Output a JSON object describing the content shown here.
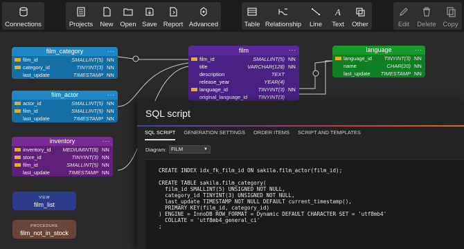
{
  "toolbar": {
    "connections": "Connections",
    "projects": "Projects",
    "new": "New",
    "open": "Open",
    "save": "Save",
    "report": "Report",
    "advanced": "Advanced",
    "table": "Table",
    "relationship": "Relationship",
    "line": "Line",
    "text": "Text",
    "other": "Other",
    "edit": "Edit",
    "delete": "Delete",
    "copy": "Copy"
  },
  "tables": {
    "film_category": {
      "name": "film_category",
      "rows": [
        {
          "name": "film_id",
          "type": "SMALLINT(5)",
          "nn": "NN"
        },
        {
          "name": "category_id",
          "type": "TINYINT(3)",
          "nn": "NN"
        },
        {
          "name": "last_update",
          "type": "TIMESTAMP",
          "nn": "NN"
        }
      ]
    },
    "film_actor": {
      "name": "film_actor",
      "rows": [
        {
          "name": "actor_id",
          "type": "SMALLINT(5)",
          "nn": "NN"
        },
        {
          "name": "film_id",
          "type": "SMALLINT(5)",
          "nn": "NN"
        },
        {
          "name": "last_update",
          "type": "TIMESTAMP",
          "nn": "NN"
        }
      ]
    },
    "inventory": {
      "name": "inventory",
      "rows": [
        {
          "name": "inventory_id",
          "type": "MEDIUMINT(8)",
          "nn": "NN"
        },
        {
          "name": "store_id",
          "type": "TINYINT(3)",
          "nn": "NN"
        },
        {
          "name": "film_id",
          "type": "SMALLINT(5)",
          "nn": "NN"
        },
        {
          "name": "last_update",
          "type": "TIMESTAMP",
          "nn": "NN"
        }
      ]
    },
    "film": {
      "name": "film",
      "rows": [
        {
          "name": "film_id",
          "type": "SMALLINT(5)",
          "nn": "NN"
        },
        {
          "name": "title",
          "type": "VARCHAR(128)",
          "nn": "NN"
        },
        {
          "name": "description",
          "type": "TEXT",
          "nn": ""
        },
        {
          "name": "release_year",
          "type": "YEAR(4)",
          "nn": ""
        },
        {
          "name": "language_id",
          "type": "TINYINT(3)",
          "nn": "NN"
        },
        {
          "name": "original_language_id",
          "type": "TINYINT(3)",
          "nn": ""
        }
      ]
    },
    "language": {
      "name": "language",
      "rows": [
        {
          "name": "language_id",
          "type": "TINYINT(3)",
          "nn": "NN"
        },
        {
          "name": "name",
          "type": "CHAR(20)",
          "nn": "NN"
        },
        {
          "name": "last_update",
          "type": "TIMESTAMP",
          "nn": "NN"
        }
      ]
    }
  },
  "view": {
    "kind": "VIEW",
    "name": "film_list"
  },
  "procedure": {
    "kind": "PROCEDURE",
    "name": "film_not_in_stock"
  },
  "dots": "···",
  "dialog": {
    "title": "SQL script",
    "tabs": [
      "SQL SCRIPT",
      "GENERATION SETTINGS",
      "ORDER ITEMS",
      "SCRIPT AND TEMPLATES"
    ],
    "diagram_label": "Diagram:",
    "diagram_value": "FILM",
    "code": "CREATE INDEX idx_fk_film_id ON sakila.film_actor(film_id);\n\nCREATE TABLE sakila.film_category(\n  film_id SMALLINT(5) UNSIGNED NOT NULL,\n  category_id TINYINT(3) UNSIGNED NOT NULL,\n  last_update TIMESTAMP NOT NULL DEFAULT current_timestamp(),\n  PRIMARY KEY(film_id, category_id)\n) ENGINE = InnoDB ROW_FORMAT = Dynamic DEFAULT CHARACTER SET = 'utf8mb4'\n  COLLATE = 'utf8mb4_general_ci'\n;"
  }
}
